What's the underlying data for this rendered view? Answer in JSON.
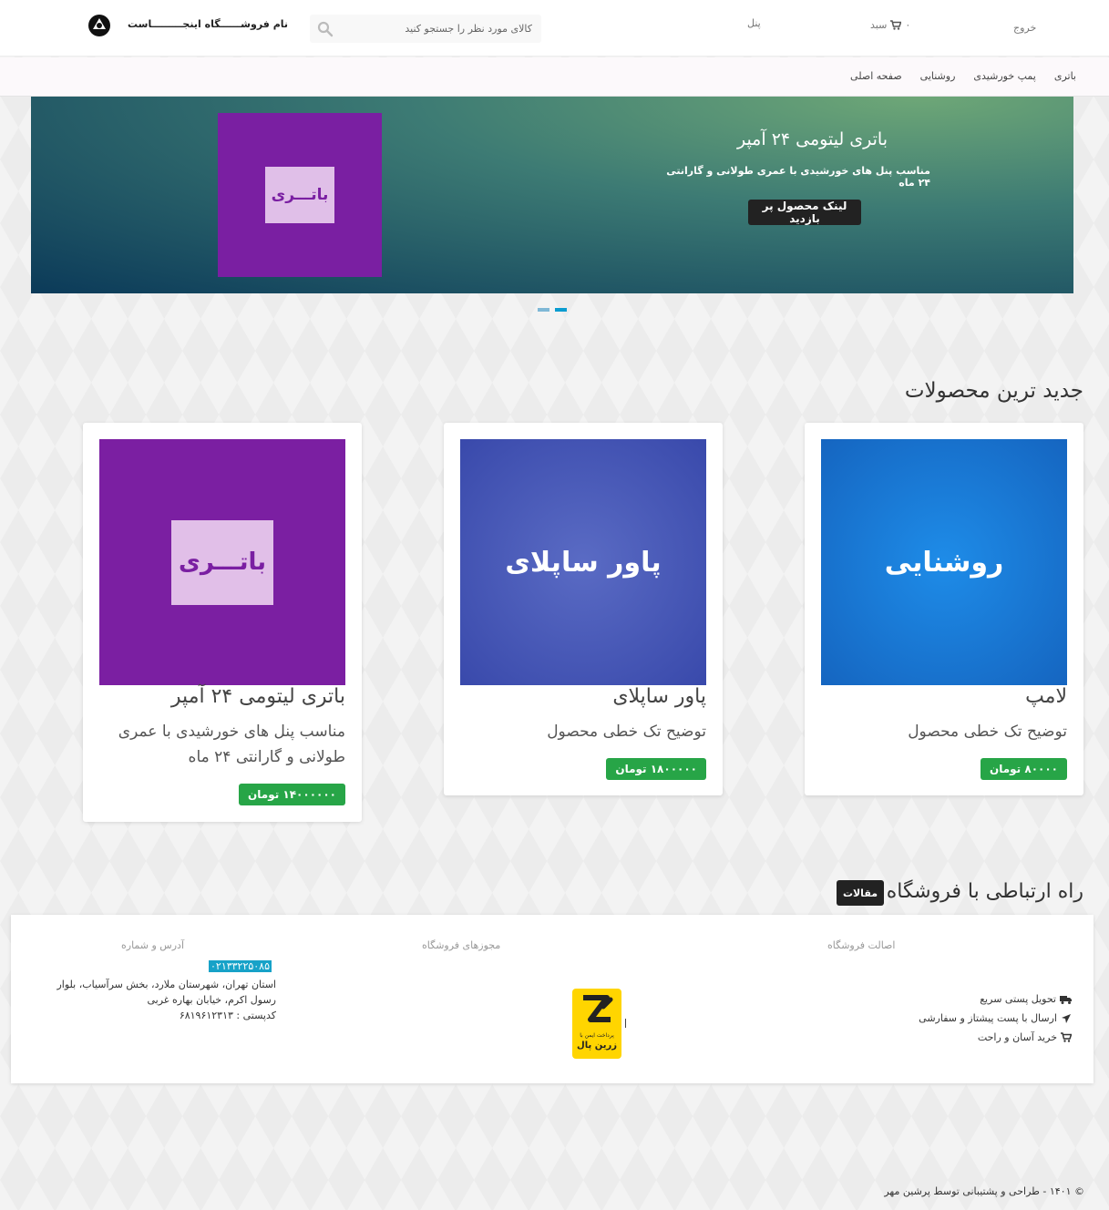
{
  "header": {
    "store_name": "نام فروشــــــگاه اینجـــــــــاست",
    "search_placeholder": "کالای مورد نظر را جستجو کنید",
    "panel_label": "پنل",
    "cart_label": "سبد",
    "cart_count": "۰",
    "logout_label": "خروج"
  },
  "nav": {
    "items": [
      "صفحه اصلی",
      "روشنایی",
      "پمپ خورشیدی",
      "باتری"
    ]
  },
  "slider": {
    "image_text": "باتـــری",
    "title": "باتری لیتومی ۲۴ آمپر",
    "description": "مناسب پنل های خورشیدی با عمری طولانی و گارانتی ۲۴ ماه",
    "button_label": "لینک محصول پر بازدید"
  },
  "products_section": {
    "title": "جدید ترین محصولات",
    "items": [
      {
        "image_text": "روشنایی",
        "title": "لامپ",
        "description": "توضیح تک خطی محصول",
        "price": "۸۰۰۰۰ تومان",
        "color": "#1e88e5"
      },
      {
        "image_text": "پاور ساپلای",
        "title": "پاور ساپلای",
        "description": "توضیح تک خطی محصول",
        "price": "۱۸۰۰۰۰۰ تومان",
        "color": "#3f51b5"
      },
      {
        "image_text": "باتـــری",
        "title": "باتری لیتومی ۲۴ آمپر",
        "description": "مناسب پنل های خورشیدی با عمری طولانی و گارانتی ۲۴ ماه",
        "price": "۱۴۰۰۰۰۰۰ تومان",
        "color": "#7b1fa2"
      }
    ]
  },
  "contact": {
    "title": "راه ارتباطی با فروشگاه",
    "articles_button": "مقالات",
    "col_authenticity": "اصالت فروشگاه",
    "col_licenses": "مجوزهای فروشگاه",
    "col_address": "آدرس و شماره",
    "phone": "۰۲۱۳۳۲۲۵۰۸۵",
    "address_line1": "استان تهران، شهرستان ملارد، بخش سرآسیاب، بلوار رسول اکرم، خیابان بهاره غربی",
    "postal_code": "کدپستی : ۶۸۱۹۶۱۲۳۱۳",
    "features": [
      "تحویل پستی سریع",
      "ارسال با پست پیشتاز و سفارشی",
      "خرید آسان و راحت"
    ],
    "zarinpal_text": "پرداخت ایمن با",
    "zarinpal_brand": "زرین پال"
  },
  "footer": {
    "copyright": "© ۱۴۰۱ - طراحی و پشتیبانی توسط پرشین مهر"
  },
  "colors": {
    "accent_green": "#27a547",
    "phone_bg": "#17a2c8",
    "dark_button": "#222222"
  }
}
